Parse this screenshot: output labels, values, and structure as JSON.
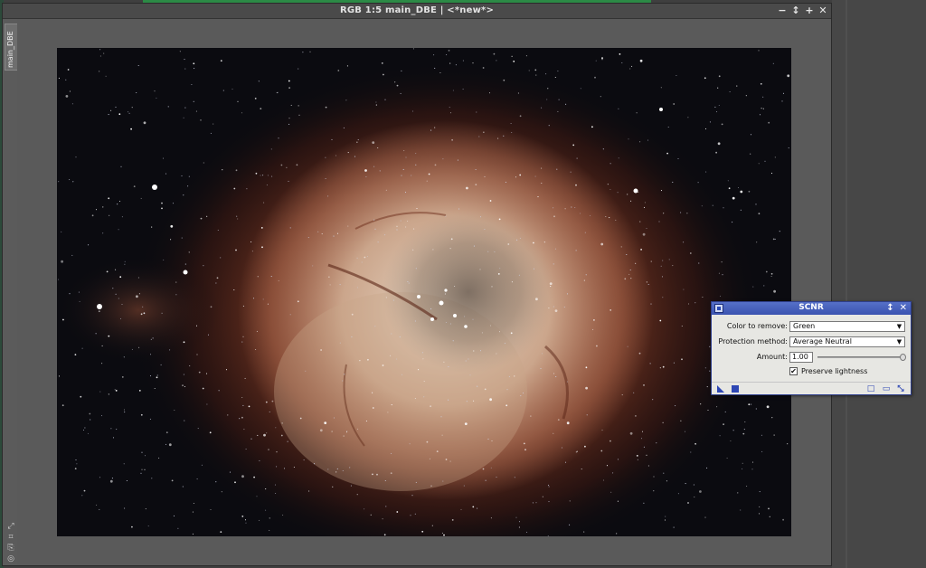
{
  "window": {
    "title": "RGB 1:5 main_DBE | <*new*>",
    "side_tab_label": "main_DBE",
    "buttons": {
      "minimize": "−",
      "shade": "↕",
      "maximize": "+",
      "close": "✕"
    }
  },
  "side_icons": [
    "⤢",
    "⌗",
    "⎘",
    "◎"
  ],
  "scnr": {
    "title": "SCNR",
    "title_buttons": {
      "shade": "↕",
      "close": "✕"
    },
    "color_label": "Color to remove:",
    "color_value": "Green",
    "protection_label": "Protection method:",
    "protection_value": "Average Neutral",
    "amount_label": "Amount:",
    "amount_value": "1.00",
    "amount_slider": 1.0,
    "preserve_label": "Preserve lightness",
    "preserve_checked": true,
    "bottom_icons": [
      "new-instance-icon",
      "execute-icon",
      "reset-icon",
      "documentation-icon",
      "preferences-icon"
    ]
  },
  "colors": {
    "accent": "#3a53b0",
    "nebula_core": "#e8d8c4",
    "nebula_mid": "#c07656",
    "nebula_outer": "#6b2a18",
    "sky": "#0a0a0f"
  }
}
